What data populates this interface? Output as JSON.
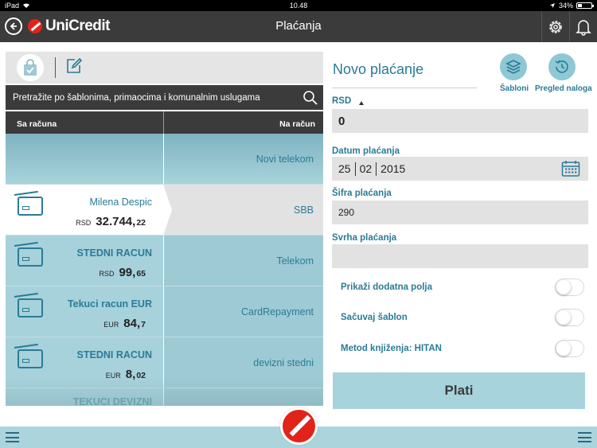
{
  "status_bar": {
    "device": "iPad",
    "time": "10.48",
    "battery": "34%"
  },
  "header": {
    "brand": "UniCredit",
    "title": "Plaćanja"
  },
  "left": {
    "search_placeholder": "Pretražite po šablonima, primaocima i komunalnim uslugama",
    "col_from": "Sa računa",
    "col_to": "Na račun",
    "rows": [
      {
        "account": "",
        "currency": "",
        "amount": "",
        "amount_dec": "",
        "recipient": "Novi telekom"
      },
      {
        "account": "Milena Despic",
        "currency": "RSD",
        "amount": "32.744,",
        "amount_dec": "22",
        "recipient": "SBB"
      },
      {
        "account": "STEDNI RACUN",
        "currency": "RSD",
        "amount": "99,",
        "amount_dec": "65",
        "recipient": "Telekom"
      },
      {
        "account": "Tekuci racun EUR",
        "currency": "EUR",
        "amount": "84,",
        "amount_dec": "7",
        "recipient": "CardRepayment"
      },
      {
        "account": "STEDNI RACUN",
        "currency": "EUR",
        "amount": "8,",
        "amount_dec": "02",
        "recipient": "devizni stedni"
      },
      {
        "account": "TEKUCI DEVIZNI"
      }
    ]
  },
  "form": {
    "title": "Novo plaćanje",
    "btn_templates": "Šabloni",
    "btn_history": "Pregled naloga",
    "currency": "RSD",
    "amount": "0",
    "date_label": "Datum plaćanja",
    "date_day": "25",
    "date_month": "02",
    "date_year": "2015",
    "code_label": "Šifra plaćanja",
    "code_value": "290",
    "purpose_label": "Svrha plaćanja",
    "purpose_value": "",
    "toggle_extra": "Prikaži dodatna polja",
    "toggle_template": "Sačuvaj šablon",
    "toggle_method": "Metod knjiženja: HITAN",
    "submit": "Plati"
  },
  "colors": {
    "accent": "#2a7b96",
    "header": "#3b3b3b",
    "brand_red": "#e2231a",
    "teal_light": "#a7d3dc"
  },
  "icons": [
    "back-arrow-icon",
    "unicredit-logo-icon",
    "gear-icon",
    "bell-icon",
    "shopping-bag-icon",
    "edit-icon",
    "search-icon",
    "card-icon",
    "templates-icon",
    "history-icon",
    "calendar-icon",
    "menu-icon"
  ]
}
